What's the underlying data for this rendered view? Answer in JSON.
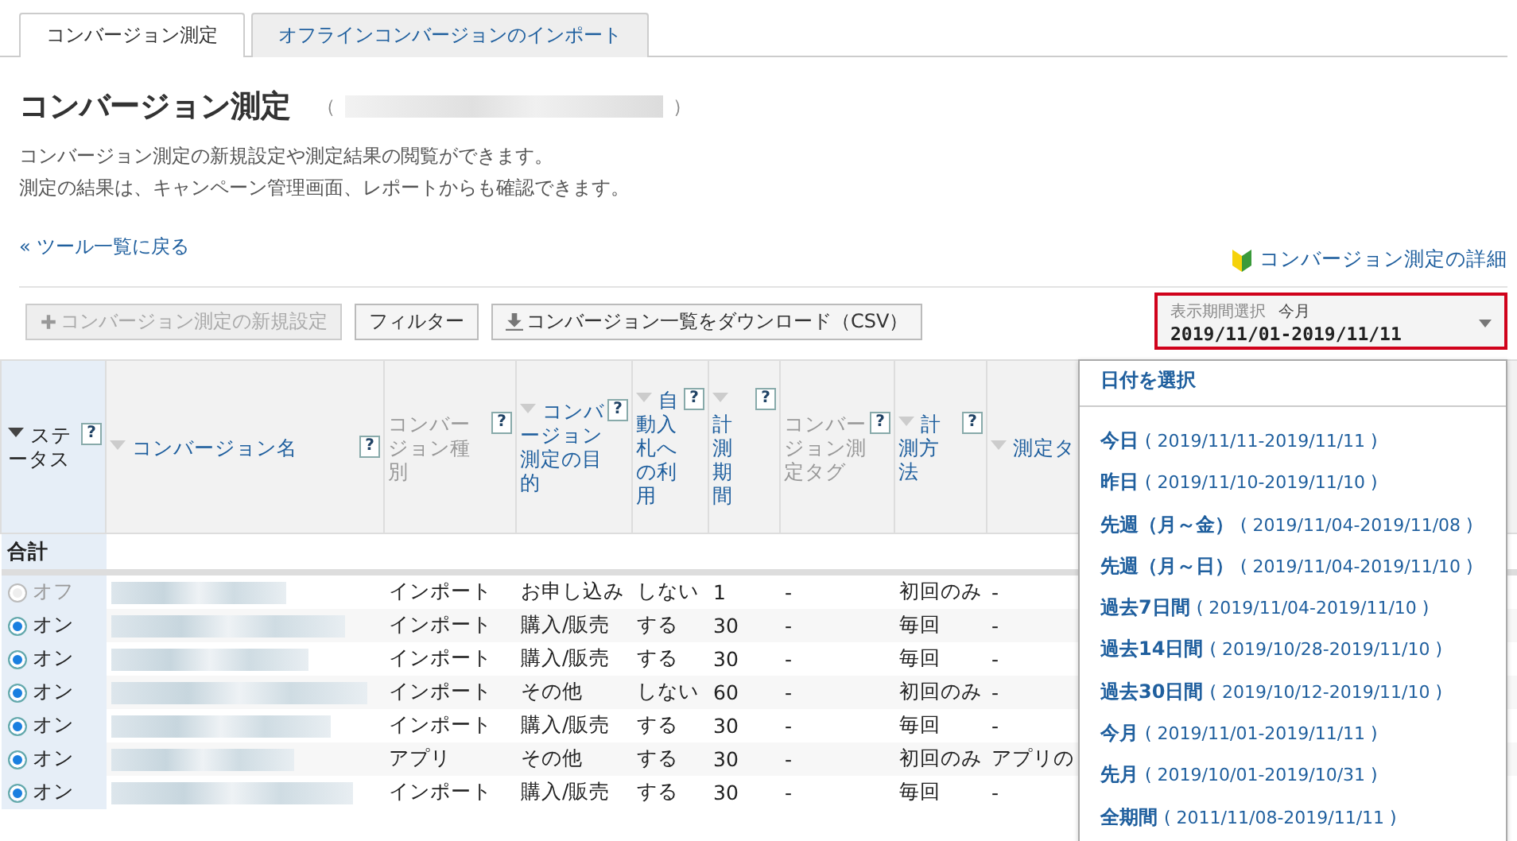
{
  "tabs": [
    {
      "label": "コンバージョン測定",
      "selected": true
    },
    {
      "label": "オフラインコンバージョンのインポート",
      "selected": false
    }
  ],
  "page_title": "コンバージョン測定",
  "title_parens": [
    "（",
    "）"
  ],
  "description": [
    "コンバージョン測定の新規設定や測定結果の閲覧ができます。",
    "測定の結果は、キャンペーン管理画面、レポートからも確認できます。"
  ],
  "back_link": "« ツール一覧に戻る",
  "detail_link": "コンバージョン測定の詳細",
  "toolbar": [
    {
      "label": "コンバージョン測定の新規設定",
      "kind": "add",
      "disabled": true
    },
    {
      "label": "フィルター",
      "kind": "plain",
      "disabled": false
    },
    {
      "label": "コンバージョン一覧をダウンロード（CSV）",
      "kind": "download",
      "disabled": false
    }
  ],
  "period_selector": {
    "caption": "表示期間選択",
    "preset": "今月",
    "range": "2019/11/01-2019/11/11"
  },
  "period_menu": {
    "header": "日付を選択",
    "options": [
      {
        "label": "今日",
        "range": "( 2019/11/11-2019/11/11 )"
      },
      {
        "label": "昨日",
        "range": "( 2019/11/10-2019/11/10 )"
      },
      {
        "label": "先週（月～金）",
        "range": "( 2019/11/04-2019/11/08 )"
      },
      {
        "label": "先週（月～日）",
        "range": "( 2019/11/04-2019/11/10 )"
      },
      {
        "label": "過去7日間",
        "range": "( 2019/11/04-2019/11/10 )"
      },
      {
        "label": "過去14日間",
        "range": "( 2019/10/28-2019/11/10 )"
      },
      {
        "label": "過去30日間",
        "range": "( 2019/10/12-2019/11/10 )"
      },
      {
        "label": "今月",
        "range": "( 2019/11/01-2019/11/11 )"
      },
      {
        "label": "先月",
        "range": "( 2019/10/01-2019/10/31 )"
      },
      {
        "label": "全期間",
        "range": "( 2011/11/08-2019/11/11 )"
      }
    ]
  },
  "table": {
    "columns": [
      {
        "label": "ステータス",
        "sortable": true,
        "sorted": true,
        "help": "?"
      },
      {
        "label": "コンバージョン名",
        "sortable": true,
        "sorted": false,
        "help": "?"
      },
      {
        "label": "コンバージョン種別",
        "sortable": false,
        "sorted": false,
        "help": "?"
      },
      {
        "label": "コンバージョン測定の目的",
        "sortable": true,
        "sorted": false,
        "help": "?"
      },
      {
        "label": "自動入札への利用",
        "sortable": true,
        "sorted": false,
        "help": "?"
      },
      {
        "label": "計測期間",
        "sortable": true,
        "sorted": false,
        "help": "?"
      },
      {
        "label": "コンバージョン測定タグ",
        "sortable": false,
        "sorted": false,
        "help": "?"
      },
      {
        "label": "計測方法",
        "sortable": true,
        "sorted": false,
        "help": "?"
      },
      {
        "label": "測定タ",
        "sortable": true,
        "sorted": false
      }
    ],
    "total_label": "合計",
    "rows": [
      {
        "on": false,
        "cells": [
          "オフ",
          "",
          "インポート",
          "お申し込み",
          "しない",
          "1",
          "-",
          "初回のみ",
          "-"
        ]
      },
      {
        "on": true,
        "cells": [
          "オン",
          "",
          "インポート",
          "購入/販売",
          "する",
          "30",
          "-",
          "毎回",
          "-"
        ]
      },
      {
        "on": true,
        "cells": [
          "オン",
          "",
          "インポート",
          "購入/販売",
          "する",
          "30",
          "-",
          "毎回",
          "-"
        ]
      },
      {
        "on": true,
        "cells": [
          "オン",
          "",
          "インポート",
          "その他",
          "しない",
          "60",
          "-",
          "初回のみ",
          "-"
        ]
      },
      {
        "on": true,
        "cells": [
          "オン",
          "",
          "インポート",
          "購入/販売",
          "する",
          "30",
          "-",
          "毎回",
          "-"
        ]
      },
      {
        "on": true,
        "cells": [
          "オン",
          "",
          "アプリ",
          "その他",
          "する",
          "30",
          "-",
          "初回のみ",
          "アプリの"
        ]
      },
      {
        "on": true,
        "cells": [
          "オン",
          "",
          "インポート",
          "購入/販売",
          "する",
          "30",
          "-",
          "毎回",
          "-"
        ]
      }
    ]
  }
}
